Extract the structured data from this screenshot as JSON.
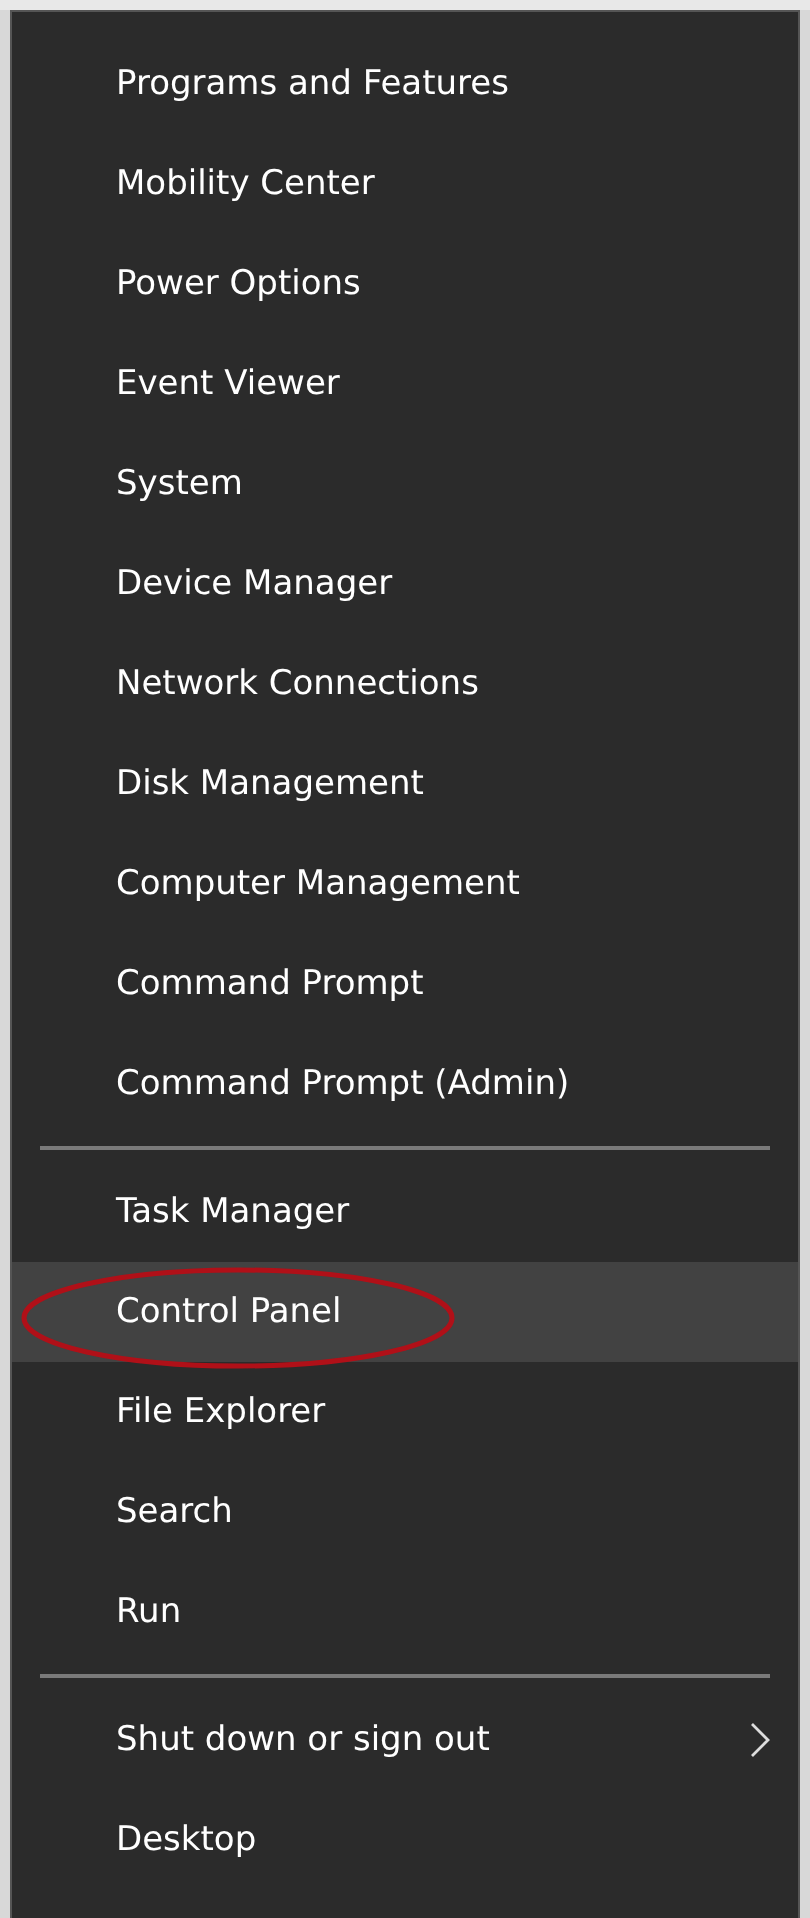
{
  "menu": {
    "groups": [
      {
        "items": [
          {
            "label": "Programs and Features",
            "kind": "command",
            "selected": false,
            "circled": false
          },
          {
            "label": "Mobility Center",
            "kind": "command",
            "selected": false,
            "circled": false
          },
          {
            "label": "Power Options",
            "kind": "command",
            "selected": false,
            "circled": false
          },
          {
            "label": "Event Viewer",
            "kind": "command",
            "selected": false,
            "circled": false
          },
          {
            "label": "System",
            "kind": "command",
            "selected": false,
            "circled": false
          },
          {
            "label": "Device Manager",
            "kind": "command",
            "selected": false,
            "circled": false
          },
          {
            "label": "Network Connections",
            "kind": "command",
            "selected": false,
            "circled": false
          },
          {
            "label": "Disk Management",
            "kind": "command",
            "selected": false,
            "circled": false
          },
          {
            "label": "Computer Management",
            "kind": "command",
            "selected": false,
            "circled": false
          },
          {
            "label": "Command Prompt",
            "kind": "command",
            "selected": false,
            "circled": false
          },
          {
            "label": "Command Prompt (Admin)",
            "kind": "command",
            "selected": false,
            "circled": false
          }
        ]
      },
      {
        "items": [
          {
            "label": "Task Manager",
            "kind": "command",
            "selected": false,
            "circled": false
          },
          {
            "label": "Control Panel",
            "kind": "command",
            "selected": true,
            "circled": true
          },
          {
            "label": "File Explorer",
            "kind": "command",
            "selected": false,
            "circled": false
          },
          {
            "label": "Search",
            "kind": "command",
            "selected": false,
            "circled": false
          },
          {
            "label": "Run",
            "kind": "command",
            "selected": false,
            "circled": false
          }
        ]
      },
      {
        "items": [
          {
            "label": "Shut down or sign out",
            "kind": "submenu",
            "selected": false,
            "circled": false
          },
          {
            "label": "Desktop",
            "kind": "command",
            "selected": false,
            "circled": false
          }
        ]
      }
    ]
  }
}
